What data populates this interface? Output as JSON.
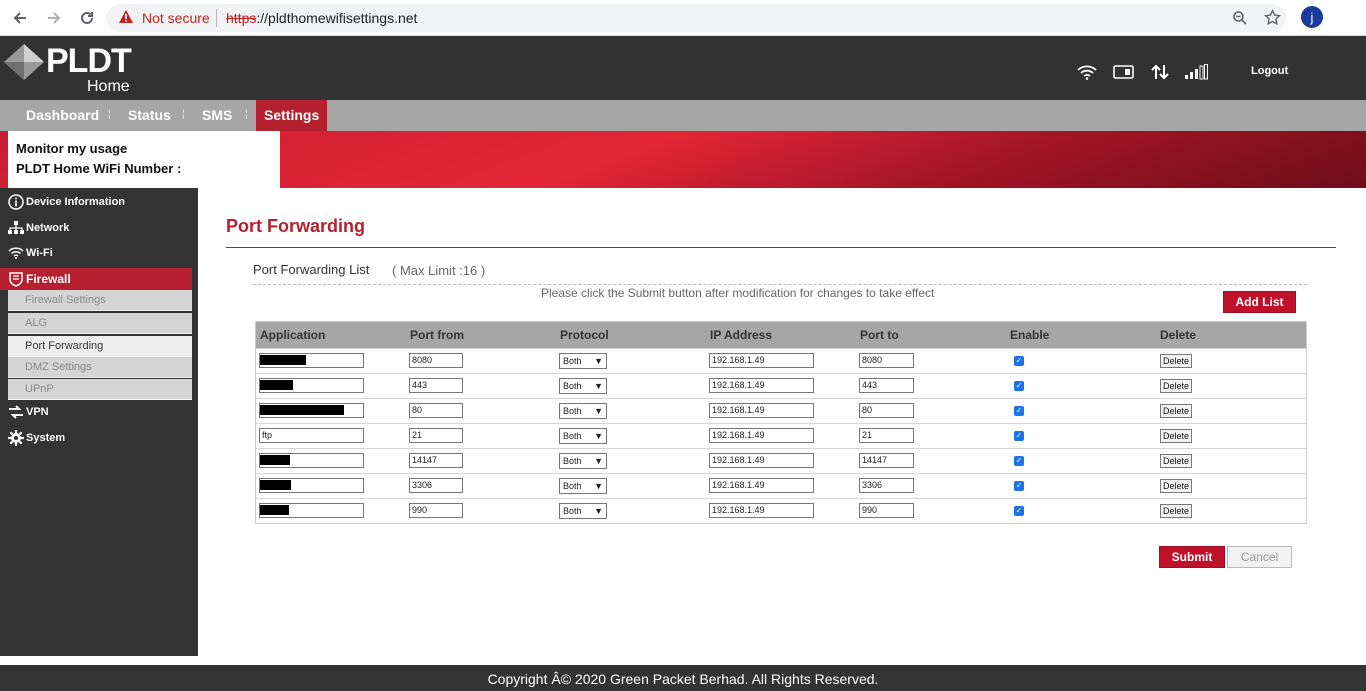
{
  "browser": {
    "not_secure": "Not secure",
    "url_scheme": "https",
    "url_rest": "://pldthomewifisettings.net",
    "avatar_letter": "j"
  },
  "header": {
    "logo_text": "PLDT",
    "logo_sub": "Home",
    "logout": "Logout"
  },
  "topnav": {
    "items": [
      "Dashboard",
      "Status",
      "SMS",
      "Settings"
    ],
    "active": "Settings"
  },
  "banner": {
    "line1": "Monitor my usage",
    "line2": "PLDT Home WiFi Number :"
  },
  "sidebar": {
    "items": [
      "Device Information",
      "Network",
      "Wi-Fi",
      "Firewall",
      "VPN",
      "System"
    ],
    "active": "Firewall",
    "subitems": [
      "Firewall Settings",
      "ALG",
      "Port Forwarding",
      "DMZ Settings",
      "UPnP"
    ],
    "active_sub": "Port Forwarding"
  },
  "main": {
    "title": "Port Forwarding",
    "list_title": "Port Forwarding List",
    "max_limit": "( Max Limit :16 )",
    "hint": "Please click the Submit button after modification for changes to take effect",
    "add_list": "Add List",
    "submit": "Submit",
    "cancel": "Cancel"
  },
  "table": {
    "headers": [
      "Application",
      "Port from",
      "Protocol",
      "IP Address",
      "Port to",
      "Enable",
      "Delete"
    ],
    "rows": [
      {
        "application": "",
        "port_from": "8080",
        "protocol": "Both",
        "ip": "192.168.1.49",
        "port_to": "8080",
        "enabled": true,
        "delete": "Delete"
      },
      {
        "application": "",
        "port_from": "443",
        "protocol": "Both",
        "ip": "192.168.1.49",
        "port_to": "443",
        "enabled": true,
        "delete": "Delete"
      },
      {
        "application": "",
        "port_from": "80",
        "protocol": "Both",
        "ip": "192.168.1.49",
        "port_to": "80",
        "enabled": true,
        "delete": "Delete"
      },
      {
        "application": "ftp",
        "port_from": "21",
        "protocol": "Both",
        "ip": "192.168.1.49",
        "port_to": "21",
        "enabled": true,
        "delete": "Delete"
      },
      {
        "application": "",
        "port_from": "14147",
        "protocol": "Both",
        "ip": "192.168.1.49",
        "port_to": "14147",
        "enabled": true,
        "delete": "Delete"
      },
      {
        "application": "",
        "port_from": "3306",
        "protocol": "Both",
        "ip": "192.168.1.49",
        "port_to": "3306",
        "enabled": true,
        "delete": "Delete"
      },
      {
        "application": "",
        "port_from": "990",
        "protocol": "Both",
        "ip": "192.168.1.49",
        "port_to": "990",
        "enabled": true,
        "delete": "Delete"
      }
    ]
  },
  "footer": {
    "copyright": "Copyright Â© 2020 Green Packet Berhad. All Rights Reserved."
  },
  "colors": {
    "brand_red": "#b5202e",
    "dark": "#333333",
    "nav_grey": "#a6a6a6"
  }
}
